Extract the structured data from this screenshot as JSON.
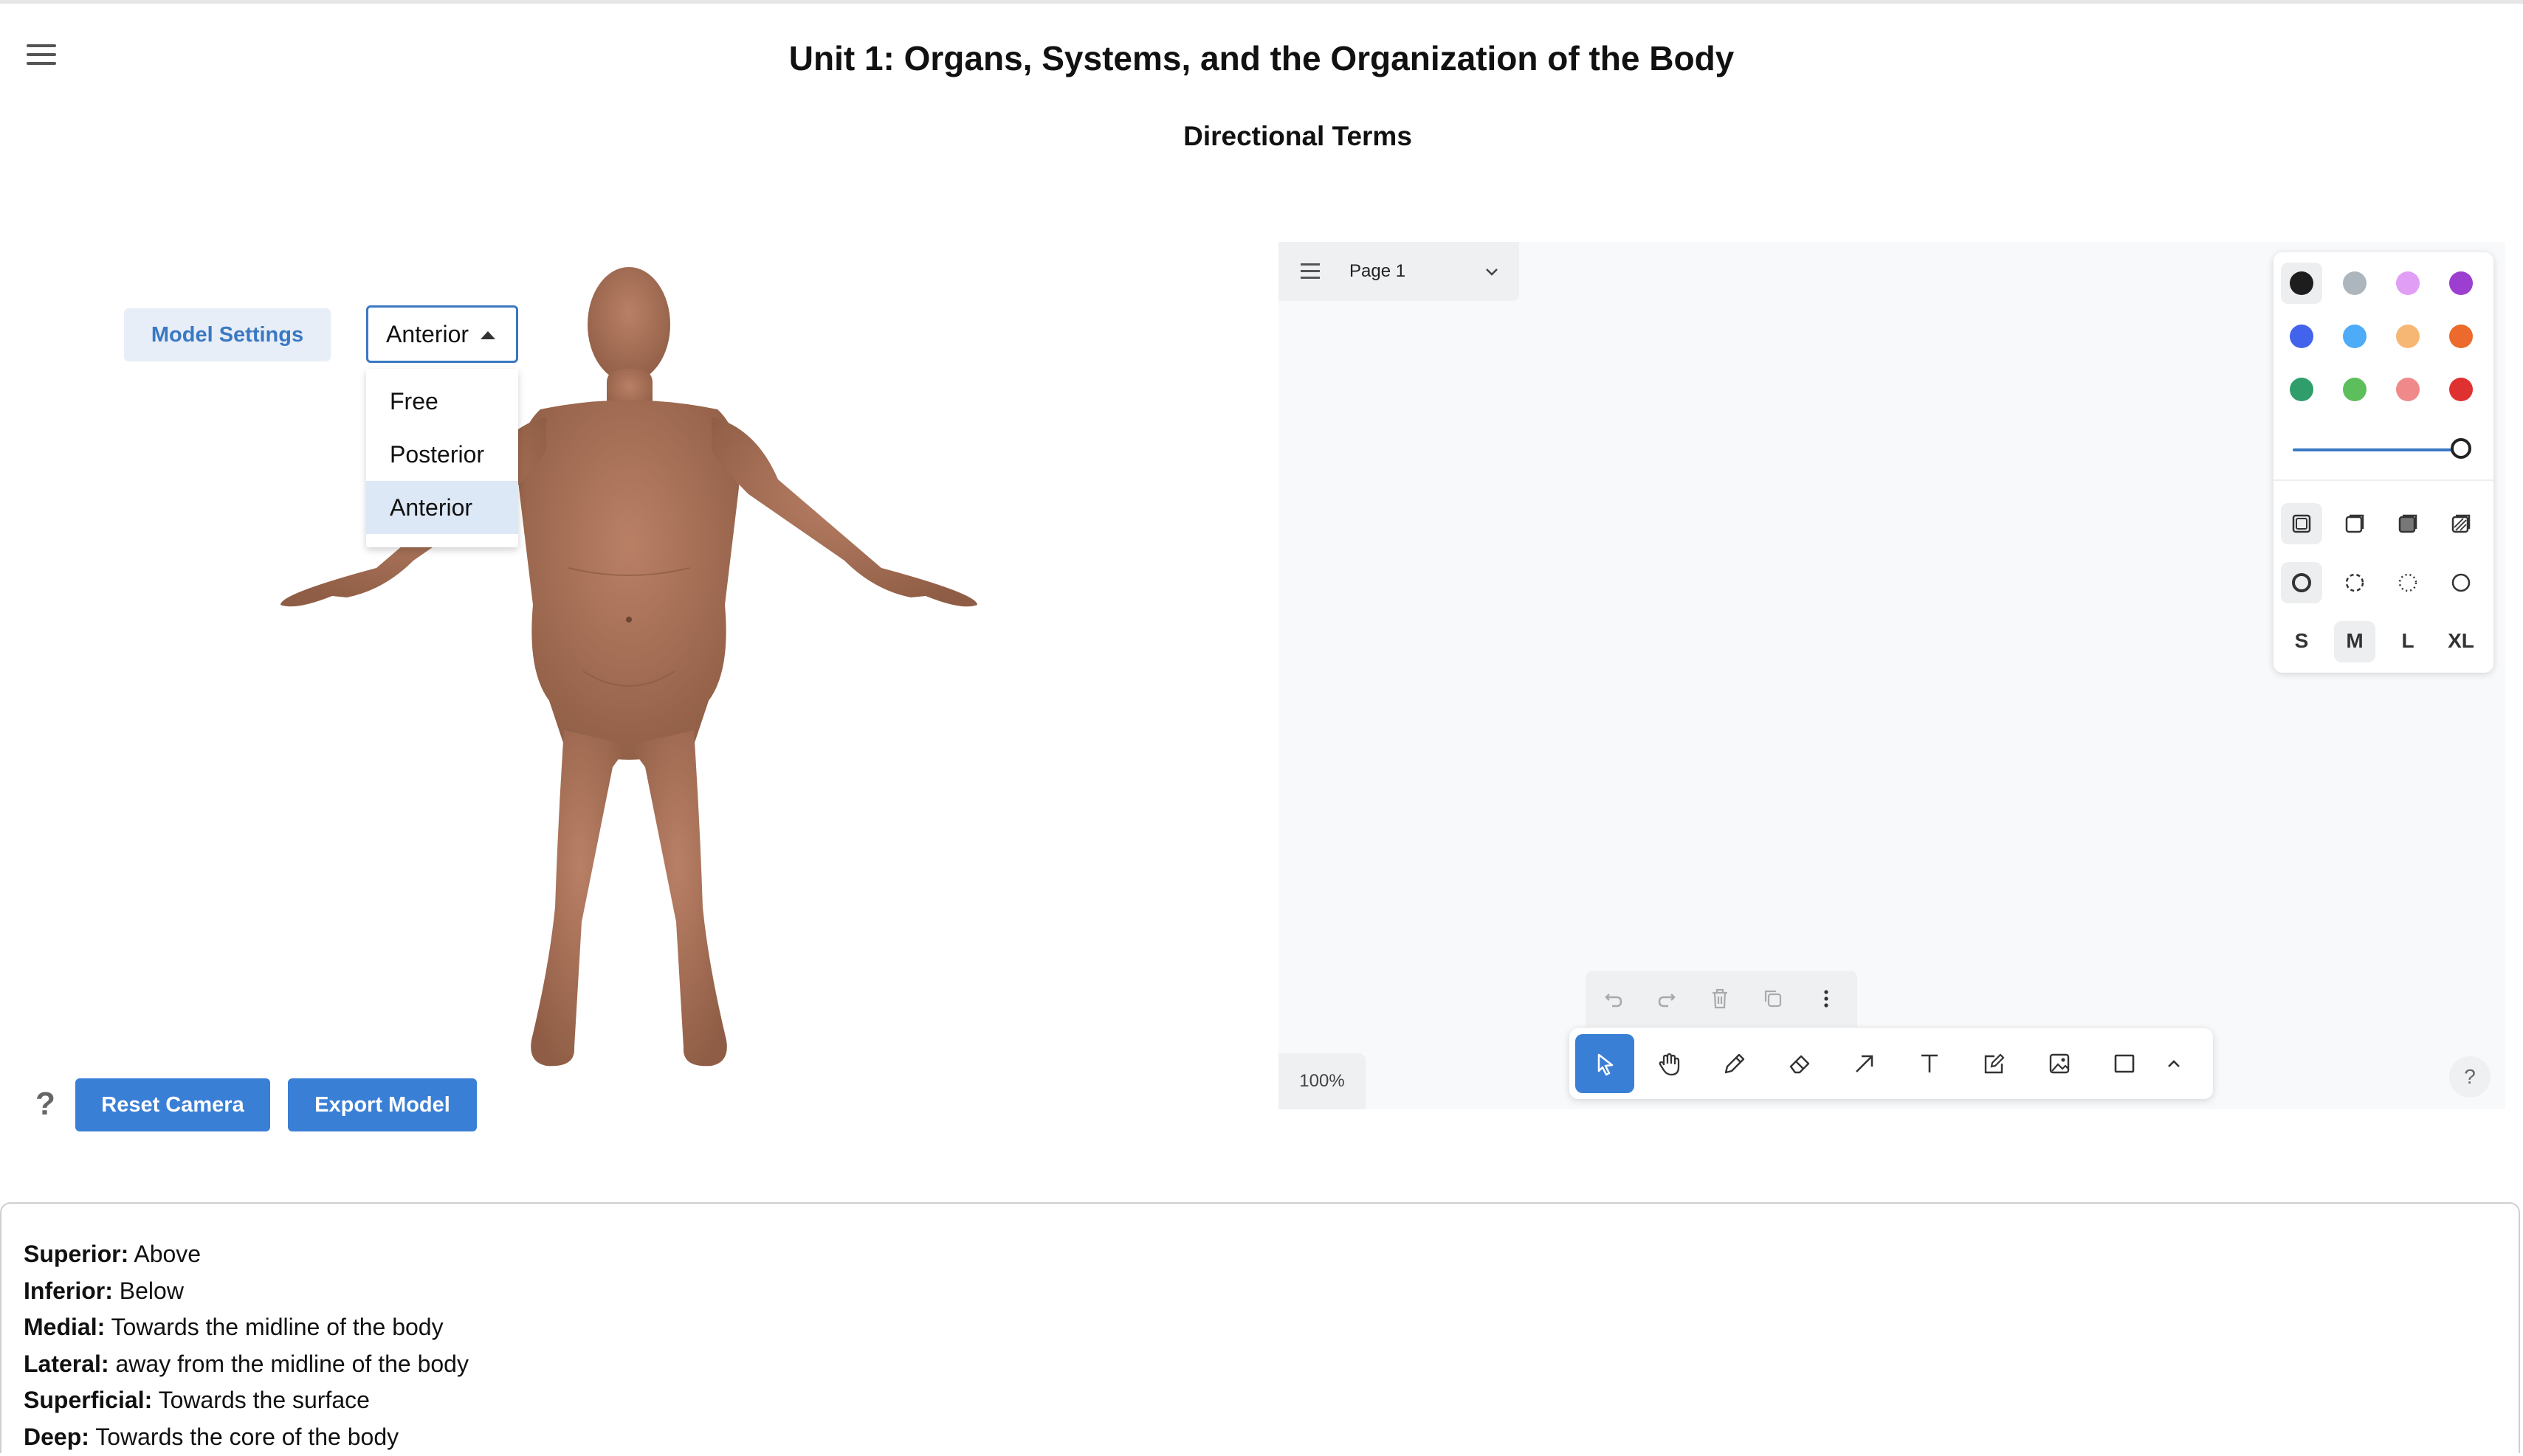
{
  "header": {
    "title": "Unit 1: Organs, Systems, and the Organization of the Body",
    "subtitle": "Directional Terms"
  },
  "model_viewer": {
    "settings_button": "Model Settings",
    "view_select": {
      "value": "Anterior",
      "options": [
        "Free",
        "Posterior",
        "Anterior"
      ]
    },
    "help_label": "?",
    "reset_button": "Reset Camera",
    "export_button": "Export Model",
    "skin_color": "#a87258"
  },
  "whiteboard": {
    "page_name": "Page 1",
    "zoom": "100%",
    "help_label": "?",
    "colors": [
      "#1d1d1d",
      "#adb5bd",
      "#e09ff5",
      "#9c3fd0",
      "#4263eb",
      "#4dabf7",
      "#f7b774",
      "#ec6a2c",
      "#2f9e6b",
      "#5cbf5c",
      "#f08a8a",
      "#e03131"
    ],
    "sizes": [
      "S",
      "M",
      "L",
      "XL"
    ],
    "selected_size": "M",
    "opacity": 1.0,
    "tools": [
      "select-icon",
      "hand-icon",
      "pencil-icon",
      "eraser-icon",
      "arrow-icon",
      "text-icon",
      "note-icon",
      "image-icon",
      "rectangle-icon",
      "chevron-up-icon"
    ],
    "active_tool": "select-icon",
    "history_actions": [
      "undo-icon",
      "redo-icon",
      "trash-icon",
      "duplicate-icon",
      "more-icon"
    ],
    "accent": "#3a7fd6"
  },
  "definitions": [
    {
      "term": "Superior:",
      "desc": " Above"
    },
    {
      "term": "Inferior:",
      "desc": " Below"
    },
    {
      "term": "Medial:",
      "desc": " Towards the midline of the body"
    },
    {
      "term": "Lateral:",
      "desc": " away from the midline of the body"
    },
    {
      "term": "Superficial:",
      "desc": " Towards the surface"
    },
    {
      "term": "Deep:",
      "desc": " Towards the core of the body"
    }
  ]
}
